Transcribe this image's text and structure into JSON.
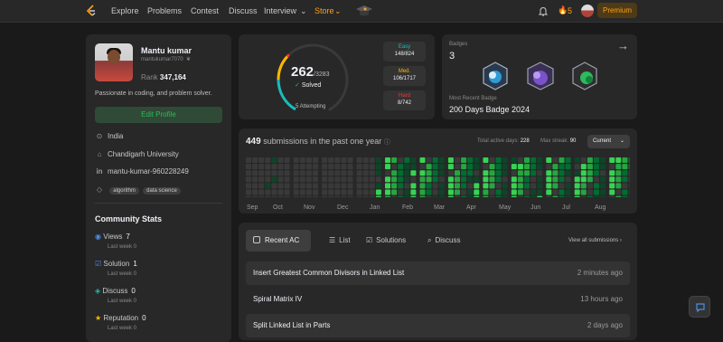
{
  "nav": {
    "items": [
      "Explore",
      "Problems",
      "Contest",
      "Discuss",
      "Interview",
      "Store"
    ],
    "streak": "5",
    "premium": "Premium"
  },
  "profile": {
    "name": "Mantu kumar",
    "username": "mantukumar7070",
    "rank_label": "Rank",
    "rank_value": "347,164",
    "bio": "Passionate in coding, and problem solver.",
    "edit_label": "Edit Profile",
    "country": "India",
    "school": "Chandigarh University",
    "linkedin": "mantu-kumar-960228249",
    "tags": [
      "algorithm",
      "data science"
    ]
  },
  "community": {
    "title": "Community Stats",
    "stats": [
      {
        "label": "Views",
        "value": "7",
        "sub": "Last week 0",
        "color": "#4a8fe7"
      },
      {
        "label": "Solution",
        "value": "1",
        "sub": "Last week 0",
        "color": "#4a8fe7"
      },
      {
        "label": "Discuss",
        "value": "0",
        "sub": "Last week 0",
        "color": "#2bb0a4"
      },
      {
        "label": "Reputation",
        "value": "0",
        "sub": "Last week 0",
        "color": "#ffb800"
      }
    ]
  },
  "solved": {
    "count": "262",
    "total": "/3283",
    "label": "Solved",
    "attempting": "5 Attempting",
    "difficulties": [
      {
        "name": "Easy",
        "value": "148/824",
        "color": "#1cbaba"
      },
      {
        "name": "Med.",
        "value": "106/1717",
        "color": "#ffb700"
      },
      {
        "name": "Hard",
        "value": "8/742",
        "color": "#f63737"
      }
    ]
  },
  "badges": {
    "title": "Badges",
    "count": "3",
    "recent_label": "Most Recent Badge",
    "recent_name": "200 Days Badge 2024"
  },
  "calendar": {
    "count": "449",
    "text": "submissions in the past one year",
    "active_label": "Total active days:",
    "active_value": "228",
    "streak_label": "Max streak:",
    "streak_value": "90",
    "select": "Current",
    "months": [
      "Sep",
      "Oct",
      "Nov",
      "Dec",
      "Jan",
      "Feb",
      "Mar",
      "Apr",
      "May",
      "Jun",
      "Jul",
      "Aug"
    ]
  },
  "submissions": {
    "tabs": [
      "Recent AC",
      "List",
      "Solutions",
      "Discuss"
    ],
    "view_all": "View all submissions",
    "rows": [
      {
        "title": "Insert Greatest Common Divisors in Linked List",
        "time": "2 minutes ago"
      },
      {
        "title": "Spiral Matrix IV",
        "time": "13 hours ago"
      },
      {
        "title": "Split Linked List in Parts",
        "time": "2 days ago"
      }
    ]
  }
}
